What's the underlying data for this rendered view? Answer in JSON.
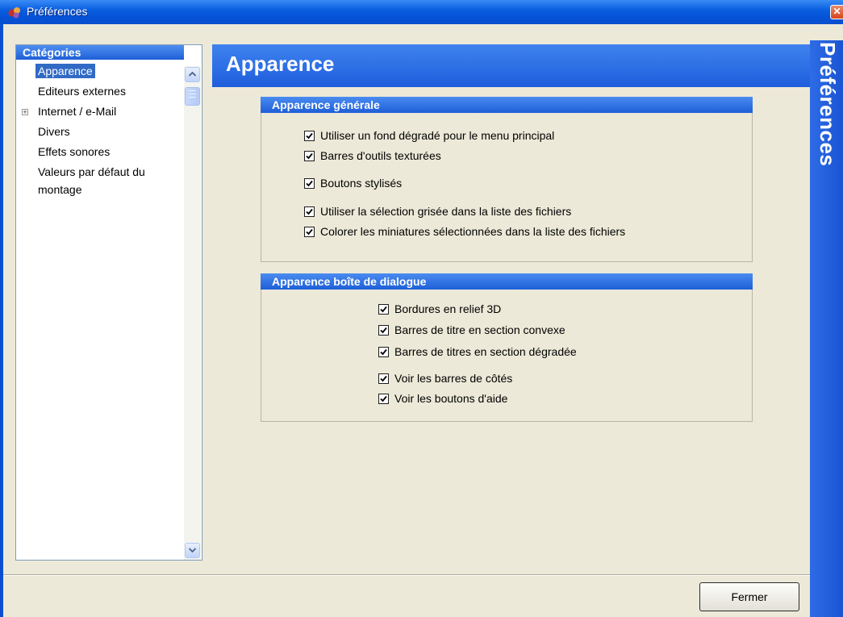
{
  "window": {
    "title": "Préférences",
    "close_glyph": "✕"
  },
  "categories": {
    "header": "Catégories",
    "items": [
      {
        "label": "Apparence",
        "selected": true,
        "expandable": false
      },
      {
        "label": "Editeurs externes",
        "selected": false,
        "expandable": false
      },
      {
        "label": "Internet / e-Mail",
        "selected": false,
        "expandable": true
      },
      {
        "label": "Divers",
        "selected": false,
        "expandable": false
      },
      {
        "label": "Effets sonores",
        "selected": false,
        "expandable": false
      },
      {
        "label": "Valeurs par défaut du montage",
        "selected": false,
        "expandable": false
      }
    ]
  },
  "page": {
    "title": "Apparence",
    "side_label": "Préférences"
  },
  "groups": [
    {
      "title": "Apparence générale",
      "options": [
        {
          "label": "Utiliser un fond dégradé pour le menu principal",
          "checked": true
        },
        {
          "label": "Barres d'outils texturées",
          "checked": true
        },
        {
          "label": "Boutons stylisés",
          "checked": true
        },
        {
          "label": "Utiliser la sélection grisée dans la liste des fichiers",
          "checked": true
        },
        {
          "label": "Colorer les miniatures sélectionnées dans la liste des fichiers",
          "checked": true
        }
      ]
    },
    {
      "title": "Apparence boîte de dialogue",
      "options": [
        {
          "label": "Bordures en relief 3D",
          "checked": true
        },
        {
          "label": "Barres de titre en section convexe",
          "checked": true
        },
        {
          "label": "Barres de titres en section dégradée",
          "checked": true
        },
        {
          "label": "Voir les barres de côtés",
          "checked": true
        },
        {
          "label": "Voir les boutons d'aide",
          "checked": true
        }
      ]
    }
  ],
  "footer": {
    "close_label": "Fermer"
  },
  "colors": {
    "accent": "#1e5fd8",
    "selection": "#316ac5",
    "background": "#ece9d8"
  },
  "icons": {
    "app": "app-icon",
    "check": "check-icon",
    "expander": "plus-icon"
  }
}
